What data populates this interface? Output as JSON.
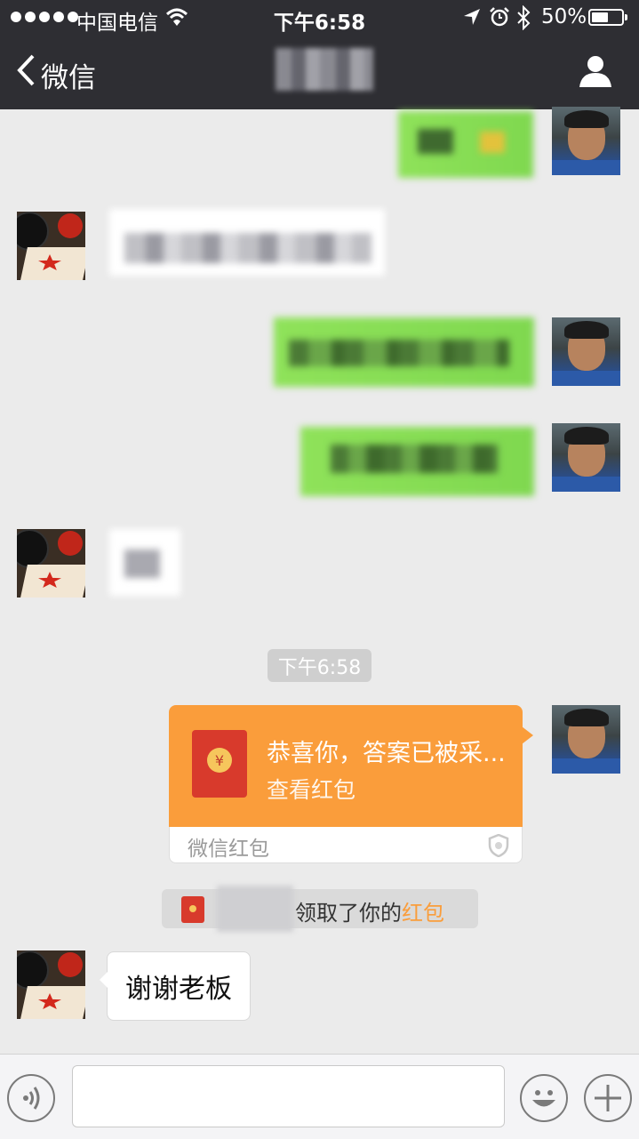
{
  "status_bar": {
    "carrier": "中国电信",
    "time": "下午6:58",
    "battery_percent": "50%",
    "battery_level": 0.5,
    "icons": [
      "signal-dots-icon",
      "wifi-icon",
      "location-arrow-icon",
      "alarm-icon",
      "bluetooth-icon",
      "battery-icon"
    ]
  },
  "nav": {
    "back_label": "微信",
    "title": "",
    "icons": [
      "chevron-left-icon",
      "profile-icon"
    ]
  },
  "chat": {
    "timestamp": "下午6:58",
    "red_packet": {
      "title": "恭喜你，答案已被采...",
      "action": "查看红包",
      "footer": "微信红包",
      "coin_symbol": "¥"
    },
    "system_notice": {
      "prefix": "领取了你的",
      "link": "红包"
    },
    "last_message": "谢谢老板"
  },
  "colors": {
    "nav_bg": "#2e2e33",
    "chat_bg": "#ebebeb",
    "my_bubble": "#8fe25a",
    "red_packet": "#fa9d3b",
    "envelope_red": "#d83a2c"
  }
}
